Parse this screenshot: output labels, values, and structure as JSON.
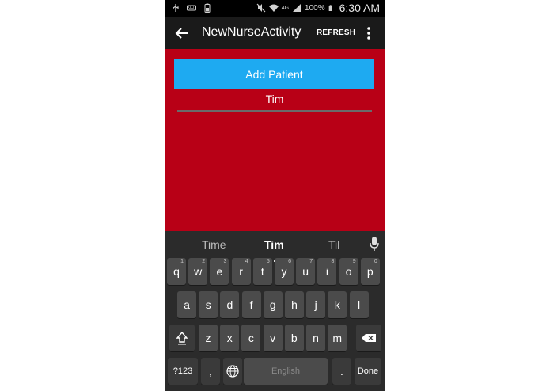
{
  "status_bar": {
    "battery_percent": "100%",
    "time": "6:30 AM",
    "network": "4G",
    "icons": [
      "usb-icon",
      "keyboard-icon",
      "battery-saver-icon",
      "mute-icon",
      "wifi-icon",
      "signal-icon",
      "battery-icon"
    ]
  },
  "action_bar": {
    "title": "NewNurseActivity",
    "refresh_label": "REFRESH"
  },
  "content": {
    "background_color": "#b80016",
    "add_patient_label": "Add Patient",
    "name_value": "Tim"
  },
  "keyboard": {
    "suggestions": [
      "Time",
      "Tim",
      "Til"
    ],
    "row1": [
      {
        "k": "q",
        "n": "1"
      },
      {
        "k": "w",
        "n": "2"
      },
      {
        "k": "e",
        "n": "3"
      },
      {
        "k": "r",
        "n": "4"
      },
      {
        "k": "t",
        "n": "5"
      },
      {
        "k": "y",
        "n": "6"
      },
      {
        "k": "u",
        "n": "7"
      },
      {
        "k": "i",
        "n": "8"
      },
      {
        "k": "o",
        "n": "9"
      },
      {
        "k": "p",
        "n": "0"
      }
    ],
    "row2": [
      "a",
      "s",
      "d",
      "f",
      "g",
      "h",
      "j",
      "k",
      "l"
    ],
    "row3": [
      "z",
      "x",
      "c",
      "v",
      "b",
      "n",
      "m"
    ],
    "sym_label": "?123",
    "comma_label": ",",
    "space_label": "English",
    "period_label": ".",
    "done_label": "Done"
  }
}
